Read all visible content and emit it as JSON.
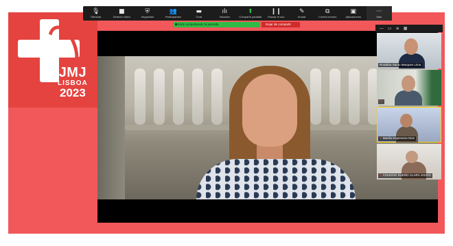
{
  "brand": {
    "logo_line1": "JMJ",
    "logo_line2": "LISBOA",
    "logo_line3": "2023"
  },
  "toolbar": {
    "buttons": [
      {
        "label": "Silenciar",
        "icon": "microphone-icon"
      },
      {
        "label": "Detener vídeo",
        "icon": "video-camera-icon"
      },
      {
        "label": "Seguridad",
        "icon": "shield-icon"
      },
      {
        "label": "Participantes",
        "icon": "people-icon"
      },
      {
        "label": "Chat",
        "icon": "chat-icon"
      },
      {
        "label": "Votación",
        "icon": "poll-icon"
      },
      {
        "label": "Compartir pantalla",
        "icon": "share-screen-icon"
      },
      {
        "label": "Pausar el uso",
        "icon": "pause-icon"
      },
      {
        "label": "Anotar",
        "icon": "annotate-pen-icon"
      },
      {
        "label": "Control remoto",
        "icon": "remote-control-icon"
      },
      {
        "label": "Aplicaciones",
        "icon": "apps-icon"
      },
      {
        "label": "Más",
        "icon": "more-icon"
      }
    ],
    "icon_glyphs": {
      "microphone": "🎙",
      "video": "■",
      "security": "⛨",
      "participants": "👥",
      "chat": "▬",
      "poll": "ılı",
      "share": "⬆",
      "pause": "❙❙",
      "annotate": "✎",
      "remote": "⧉",
      "apps": "▣",
      "more": "···"
    },
    "accent_color": "#2ec24b"
  },
  "share_banner": {
    "text": "Está compartiendo la pantalla",
    "stop_label": "Dejar de compartir"
  },
  "participants_panel": {
    "controls": [
      "—",
      "▭",
      "≡",
      "▦"
    ],
    "tiles": [
      {
        "name": "Rosalina Santo Marques Lima",
        "muted": false,
        "active": false
      },
      {
        "name": "",
        "muted": true,
        "active": false
      },
      {
        "name": "Manila Esperanza Diaz",
        "muted": true,
        "active": true
      },
      {
        "name": "COLEGIO SUEÑO CLARA JACKO",
        "muted": true,
        "active": false
      }
    ],
    "mic_muted_glyph": "✕"
  },
  "colors": {
    "stage_background": "#f2585a",
    "logo_panel": "#e4433f",
    "share_banner": "#2fbb46",
    "stop_share": "#d02a2a"
  }
}
